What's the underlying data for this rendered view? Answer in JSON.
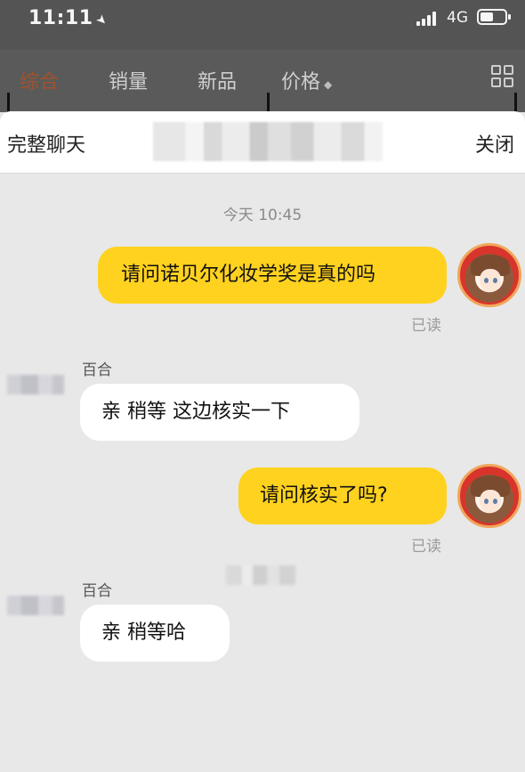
{
  "status_bar": {
    "time": "11:11",
    "network": "4G"
  },
  "filter_bar": {
    "tabs": [
      {
        "label": "综合",
        "active": true
      },
      {
        "label": "销量",
        "active": false
      },
      {
        "label": "新品",
        "active": false
      },
      {
        "label": "价格",
        "active": false
      }
    ],
    "price_sort_symbol": "◆"
  },
  "sheet": {
    "title": "完整聊天",
    "close_label": "关闭"
  },
  "chat": {
    "timestamp": "今天 10:45",
    "messages": [
      {
        "from": "self",
        "text": "请问诺贝尔化妆学奖是真的吗",
        "status": "已读"
      },
      {
        "from": "other",
        "sender": "百合",
        "text": "亲  稍等  这边核实一下"
      },
      {
        "from": "self",
        "text": "请问核实了吗?",
        "status": "已读"
      },
      {
        "from": "other",
        "sender": "百合",
        "text": "亲  稍等哈"
      }
    ]
  },
  "colors": {
    "self_bubble": "#ffd21f",
    "other_bubble": "#ffffff",
    "active_tab": "#a0522d",
    "chat_background": "#e8e8e8"
  }
}
